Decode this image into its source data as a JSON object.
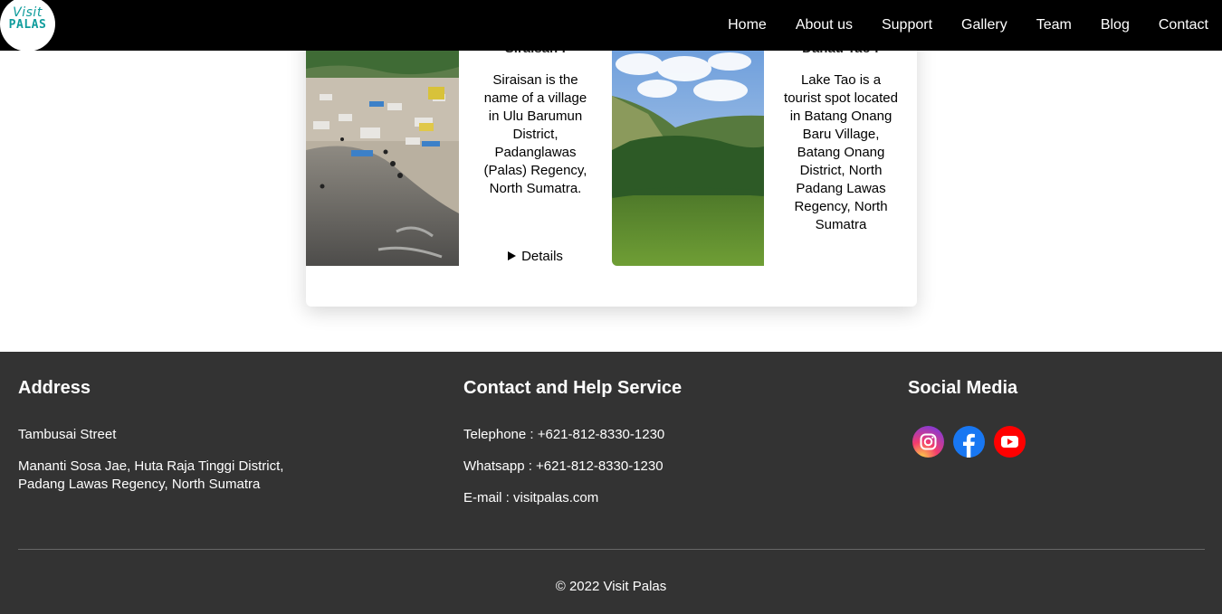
{
  "brand": {
    "line1": "Visit",
    "line2": "PALAS"
  },
  "nav": {
    "items": [
      {
        "label": "Home"
      },
      {
        "label": "About us"
      },
      {
        "label": "Support"
      },
      {
        "label": "Gallery"
      },
      {
        "label": "Team"
      },
      {
        "label": "Blog"
      },
      {
        "label": "Contact"
      }
    ]
  },
  "cards": [
    {
      "title": "Siraisan :",
      "description": "Siraisan is the name of a village in Ulu Barumun District, Padanglawas (Palas) Regency, North Sumatra.",
      "details_label": "Details"
    },
    {
      "title": "Danau Tao :",
      "description": "Lake Tao is a tourist spot located in Batang Onang Baru Village, Batang Onang District, North Padang Lawas Regency, North Sumatra"
    }
  ],
  "footer": {
    "address": {
      "heading": "Address",
      "street": "Tambusai Street",
      "location": "Mananti Sosa Jae, Huta Raja Tinggi District, Padang Lawas Regency, North Sumatra"
    },
    "contact": {
      "heading": "Contact and Help Service",
      "telephone": "Telephone : +621-812-8330-1230",
      "whatsapp": "Whatsapp : +621-812-8330-1230",
      "email": "E-mail : visitpalas.com"
    },
    "social": {
      "heading": "Social Media",
      "icons": [
        "instagram-icon",
        "facebook-icon",
        "youtube-icon"
      ]
    },
    "copyright": "© 2022 Visit Palas"
  },
  "colors": {
    "header_bg": "#000000",
    "footer_bg": "#333333",
    "brand_teal": "#0f9c9c",
    "youtube_red": "#ff0000",
    "facebook_blue": "#1877f2"
  }
}
